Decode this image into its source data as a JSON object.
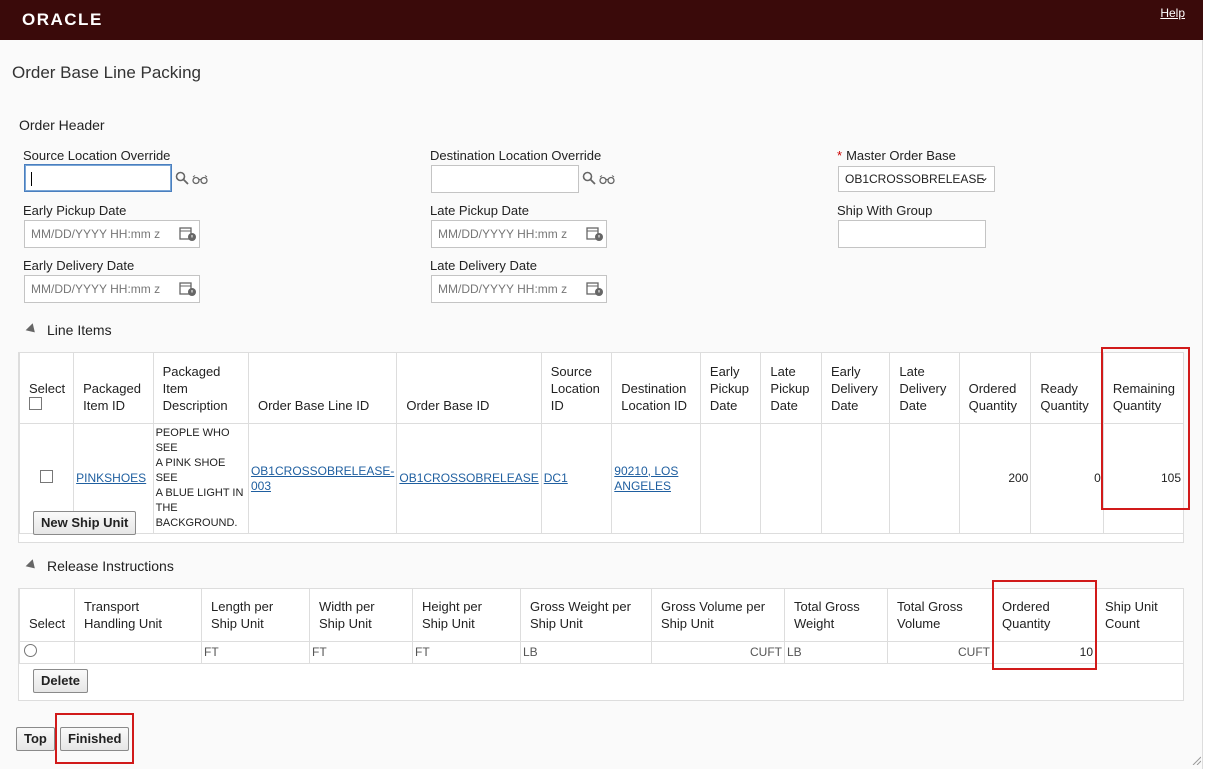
{
  "brand": "ORACLE",
  "help_label": "Help",
  "page_title": "Order Base Line Packing",
  "order_header": {
    "title": "Order Header",
    "source_location_override": {
      "label": "Source Location Override",
      "value": ""
    },
    "destination_location_override": {
      "label": "Destination Location Override",
      "value": ""
    },
    "master_order_base": {
      "required_marker": "*",
      "label": "Master Order Base",
      "selected": "OB1CROSSOBRELEASE"
    },
    "early_pickup_date": {
      "label": "Early Pickup Date",
      "placeholder": "MM/DD/YYYY HH:mm z"
    },
    "late_pickup_date": {
      "label": "Late Pickup Date",
      "placeholder": "MM/DD/YYYY HH:mm z"
    },
    "ship_with_group": {
      "label": "Ship With Group",
      "value": ""
    },
    "early_delivery_date": {
      "label": "Early Delivery Date",
      "placeholder": "MM/DD/YYYY HH:mm z"
    },
    "late_delivery_date": {
      "label": "Late Delivery Date",
      "placeholder": "MM/DD/YYYY HH:mm z"
    }
  },
  "line_items": {
    "title": "Line Items",
    "headers": {
      "select": "Select",
      "packaged_item_id": [
        "Packaged",
        "Item ID"
      ],
      "packaged_item_description": [
        "Packaged",
        "Item",
        "Description"
      ],
      "order_base_line_id": "Order Base Line ID",
      "order_base_id": "Order Base ID",
      "source_location_id": [
        "Source",
        "Location",
        "ID"
      ],
      "destination_location_id": [
        "Destination",
        "Location ID"
      ],
      "early_pickup_date": [
        "Early",
        "Pickup",
        "Date"
      ],
      "late_pickup_date": [
        "Late",
        "Pickup",
        "Date"
      ],
      "early_delivery_date": [
        "Early",
        "Delivery",
        "Date"
      ],
      "late_delivery_date": [
        "Late",
        "Delivery",
        "Date"
      ],
      "ordered_quantity": [
        "Ordered",
        "Quantity"
      ],
      "ready_quantity": [
        "Ready",
        "Quantity"
      ],
      "remaining_quantity": [
        "Remaining",
        "Quantity"
      ]
    },
    "row": {
      "packaged_item_id": "PINKSHOES",
      "description": [
        "PEOPLE WHO SEE",
        "A PINK SHOE SEE",
        "A BLUE LIGHT IN",
        "THE",
        "BACKGROUND."
      ],
      "order_base_line_id": "OB1CROSSOBRELEASE-003",
      "order_base_id": "OB1CROSSOBRELEASE",
      "source_location_id": "DC1",
      "destination_location_id": [
        "90210, LOS",
        "ANGELES"
      ],
      "early_pickup_date": "",
      "late_pickup_date": "",
      "early_delivery_date": "",
      "late_delivery_date": "",
      "ordered_quantity": "200",
      "ready_quantity": "0",
      "remaining_quantity": "105"
    },
    "new_ship_unit_button": "New Ship Unit"
  },
  "release_instructions": {
    "title": "Release Instructions",
    "headers": {
      "select": "Select",
      "transport_handling_unit": [
        "Transport",
        "Handling Unit"
      ],
      "length_per_ship_unit": [
        "Length per",
        "Ship Unit"
      ],
      "width_per_ship_unit": [
        "Width per",
        "Ship Unit"
      ],
      "height_per_ship_unit": [
        "Height per",
        "Ship Unit"
      ],
      "gross_weight_per_ship_unit": [
        "Gross Weight per",
        "Ship Unit"
      ],
      "gross_volume_per_ship_unit": [
        "Gross Volume per",
        "Ship Unit"
      ],
      "total_gross_weight": [
        "Total Gross",
        "Weight"
      ],
      "total_gross_volume": [
        "Total Gross",
        "Volume"
      ],
      "ordered_quantity": [
        "Ordered",
        "Quantity"
      ],
      "ship_unit_count": [
        "Ship Unit",
        "Count"
      ]
    },
    "row": {
      "length_unit": "FT",
      "width_unit": "FT",
      "height_unit": "FT",
      "gross_weight_unit": "LB",
      "gross_volume_unit": "CUFT",
      "total_weight_unit": "LB",
      "total_volume_unit": "CUFT",
      "ordered_quantity": "10",
      "ship_unit_count": ""
    },
    "delete_button": "Delete"
  },
  "footer": {
    "top_button": "Top",
    "finished_button": "Finished"
  },
  "highlight_color": "#d11a1a",
  "header_color": "#3a0a0a"
}
